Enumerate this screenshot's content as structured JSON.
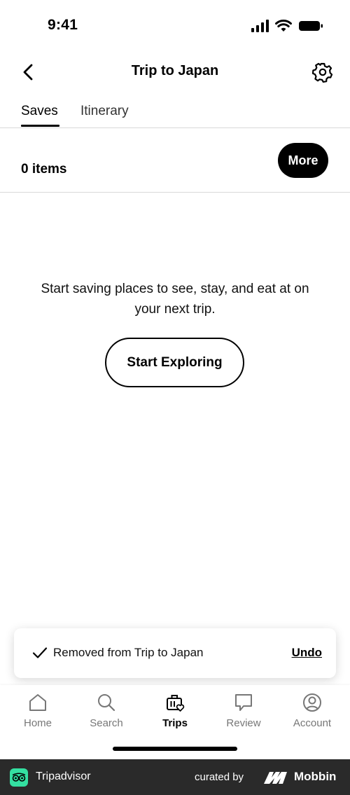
{
  "status_bar": {
    "time": "9:41"
  },
  "header": {
    "title": "Trip to Japan"
  },
  "tabs": [
    {
      "label": "Saves",
      "active": true
    },
    {
      "label": "Itinerary",
      "active": false
    }
  ],
  "summary": {
    "items_count": "0 items",
    "more_label": "More"
  },
  "empty_state": {
    "message": "Start saving places to see, stay, and eat at on your next trip.",
    "cta_label": "Start Exploring"
  },
  "toast": {
    "message": "Removed from Trip to Japan",
    "undo_label": "Undo"
  },
  "bottom_nav": {
    "items": [
      {
        "label": "Home",
        "icon": "home-icon",
        "active": false
      },
      {
        "label": "Search",
        "icon": "search-icon",
        "active": false
      },
      {
        "label": "Trips",
        "icon": "trips-icon",
        "active": true
      },
      {
        "label": "Review",
        "icon": "review-icon",
        "active": false
      },
      {
        "label": "Account",
        "icon": "account-icon",
        "active": false
      }
    ]
  },
  "footer": {
    "brand": "Tripadvisor",
    "curated_by": "curated by",
    "curator": "Mobbin"
  },
  "colors": {
    "accent": "#000000",
    "brand_green": "#34e0a1",
    "footer_bg": "#2a2a2a",
    "inactive_nav": "#777777"
  }
}
